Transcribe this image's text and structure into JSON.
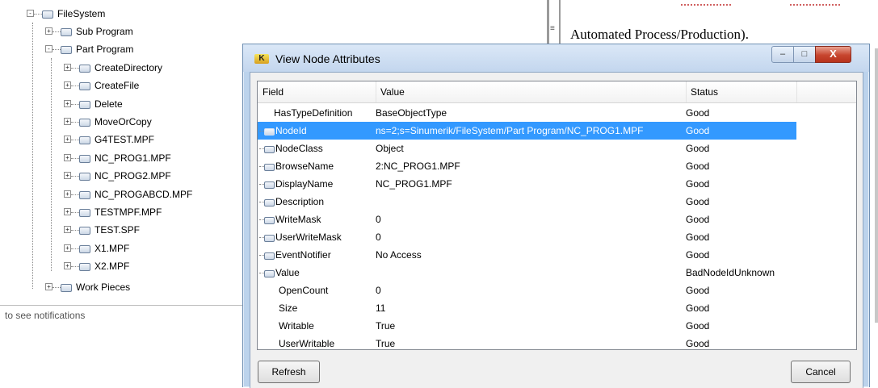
{
  "tree": {
    "root": "FileSystem",
    "children": [
      {
        "label": "Sub Program",
        "expander": "+"
      },
      {
        "label": "Part Program",
        "expander": "-",
        "children": [
          "CreateDirectory",
          "CreateFile",
          "Delete",
          "MoveOrCopy",
          "G4TEST.MPF",
          "NC_PROG1.MPF",
          "NC_PROG2.MPF",
          "NC_PROGABCD.MPF",
          "TESTMPF.MPF",
          "TEST.SPF",
          "X1.MPF",
          "X2.MPF"
        ]
      },
      {
        "label": "Work Pieces",
        "expander": "+"
      }
    ]
  },
  "notifications_text": "to see notifications",
  "background_doc": {
    "text": "Automated Process/Production)."
  },
  "dialog": {
    "title": "View Node Attributes",
    "app_icon_text": "K",
    "window_buttons": {
      "minimize": "–",
      "maximize": "□",
      "close": "X"
    },
    "columns": {
      "field": "Field",
      "value": "Value",
      "status": "Status"
    },
    "rows": [
      {
        "field": "HasTypeDefinition",
        "value": "BaseObjectType",
        "status": "Good"
      },
      {
        "field": "NodeId",
        "value": "ns=2;s=Sinumerik/FileSystem/Part Program/NC_PROG1.MPF",
        "status": "Good"
      },
      {
        "field": "NodeClass",
        "value": "Object",
        "status": "Good"
      },
      {
        "field": "BrowseName",
        "value": "2:NC_PROG1.MPF",
        "status": "Good"
      },
      {
        "field": "DisplayName",
        "value": "NC_PROG1.MPF",
        "status": "Good"
      },
      {
        "field": "Description",
        "value": "",
        "status": "Good"
      },
      {
        "field": "WriteMask",
        "value": "0",
        "status": "Good"
      },
      {
        "field": "UserWriteMask",
        "value": "0",
        "status": "Good"
      },
      {
        "field": "EventNotifier",
        "value": "No Access",
        "status": "Good"
      },
      {
        "field": "Value",
        "value": "",
        "status": "BadNodeIdUnknown"
      },
      {
        "field": "OpenCount",
        "value": "0",
        "status": "Good"
      },
      {
        "field": "Size",
        "value": "11",
        "status": "Good"
      },
      {
        "field": "Writable",
        "value": "True",
        "status": "Good"
      },
      {
        "field": "UserWritable",
        "value": "True",
        "status": "Good"
      }
    ],
    "selected_row": 1,
    "buttons": {
      "refresh": "Refresh",
      "cancel": "Cancel"
    }
  }
}
